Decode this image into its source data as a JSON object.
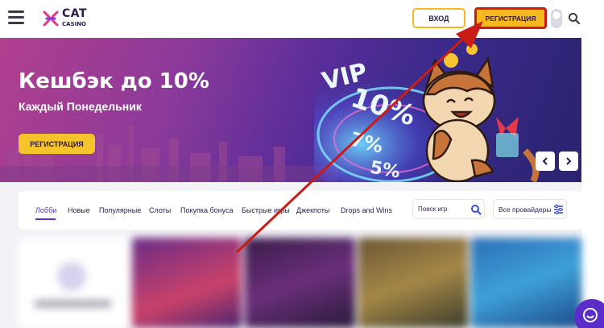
{
  "header": {
    "logo_main": "CAT",
    "logo_sub": "CASINO",
    "login_label": "ВХОД",
    "register_label": "РЕГИСТРАЦИЯ"
  },
  "banner": {
    "title": "Кешбэк до 10%",
    "subtitle": "Каждый Понедельник",
    "cta_label": "РЕГИСТРАЦИЯ",
    "art_text_vip": "VIP",
    "art_text_10": "10%",
    "art_text_7": "7%",
    "art_text_5": "5%"
  },
  "categories": {
    "items": [
      {
        "label": "Лобби",
        "active": true
      },
      {
        "label": "Новые",
        "active": false
      },
      {
        "label": "Популярные",
        "active": false
      },
      {
        "label": "Слоты",
        "active": false
      },
      {
        "label": "Покупка бонуса",
        "active": false
      },
      {
        "label": "Быстрые игры",
        "active": false
      },
      {
        "label": "Джекпоты",
        "active": false
      },
      {
        "label": "Drops and Wins",
        "active": false
      }
    ],
    "search_placeholder": "Поиск игр",
    "providers_label": "Все провайдеры"
  },
  "colors": {
    "accent": "#f5b81f",
    "brand": "#5b2cc9",
    "annotation": "#c81c14"
  },
  "icons": [
    "menu-icon",
    "cat-logo-icon",
    "search-icon",
    "chevron-left-icon",
    "chevron-right-icon",
    "filter-icon",
    "chat-icon"
  ]
}
